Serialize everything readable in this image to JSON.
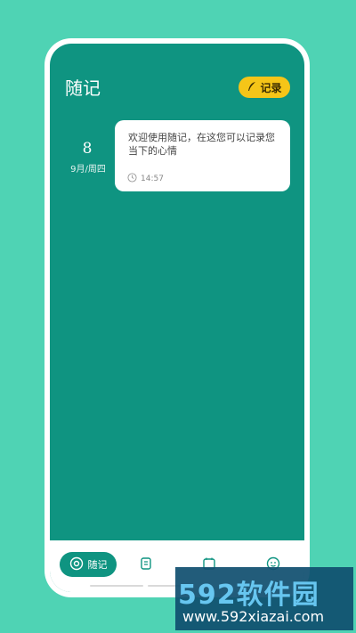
{
  "header": {
    "title": "随记",
    "record_label": "记录"
  },
  "entry": {
    "day": "8",
    "month_weekday": "9月/周四",
    "text": "欢迎使用随记，在这您可以记录您当下的心情",
    "time": "14:57"
  },
  "tabbar": {
    "active_label": "随记",
    "icons": [
      "journal-icon",
      "note-icon",
      "calendar-icon",
      "mood-icon"
    ]
  },
  "watermark": {
    "title": "592软件园",
    "url": "www.592xiazai.com"
  },
  "colors": {
    "background": "#4fd3b4",
    "screen": "#0f9481",
    "accent_button": "#f5c518",
    "card": "#ffffff"
  }
}
